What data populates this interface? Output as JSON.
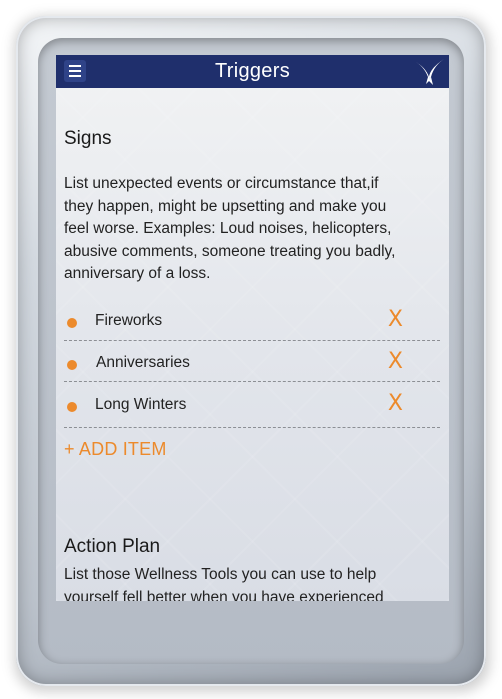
{
  "app_bar": {
    "title": "Triggers",
    "menu_icon": "hamburger-icon",
    "logo_icon": "bird-icon",
    "color": "#1f2f6c"
  },
  "signs": {
    "title": "Signs",
    "description_lines": [
      "List unexpected events or circumstance that,if",
      "they happen, might be upsetting and make you",
      "feel worse. Examples: Loud noises, helicopters,",
      "abusive comments, someone treating you badly,",
      "anniversary of a loss."
    ],
    "items": [
      {
        "label": "Fireworks",
        "delete": "X"
      },
      {
        "label": "Anniversaries",
        "delete": "X"
      },
      {
        "label": "Long Winters",
        "delete": "X"
      }
    ],
    "add_item": "+ ADD ITEM"
  },
  "action_plan": {
    "title": "Action Plan",
    "description_lines": [
      "List those Wellness Tools you can use to help",
      "yourself fell better when you have experienced"
    ]
  },
  "colors": {
    "accent": "#ec8a2c",
    "header": "#1f2f6c"
  }
}
